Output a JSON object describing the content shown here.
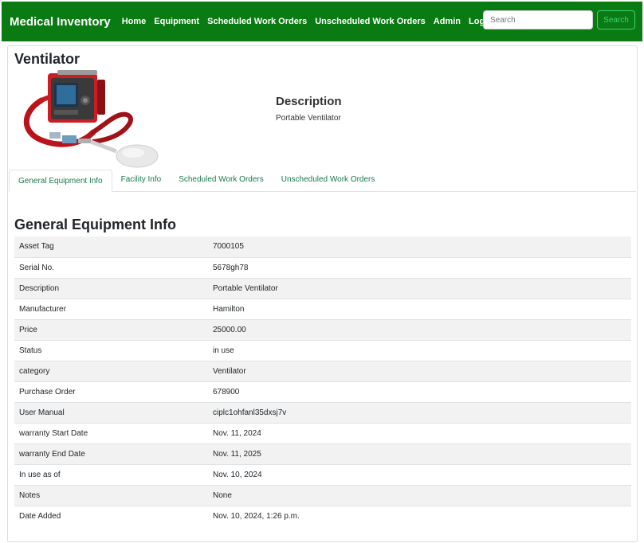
{
  "navbar": {
    "brand": "Medical Inventory",
    "links": [
      "Home",
      "Equipment",
      "Scheduled Work Orders",
      "Unscheduled Work Orders",
      "Admin",
      "Logout"
    ],
    "search_placeholder": "Search",
    "search_button": "Search"
  },
  "equipment": {
    "name": "Ventilator",
    "description_heading": "Description",
    "description": "Portable Ventilator"
  },
  "tabs": [
    {
      "label": "General Equipment Info",
      "active": true
    },
    {
      "label": "Facility Info",
      "active": false
    },
    {
      "label": "Scheduled Work Orders",
      "active": false
    },
    {
      "label": "Unscheduled Work Orders",
      "active": false
    }
  ],
  "info_section": {
    "heading": "General Equipment Info",
    "rows": [
      {
        "label": "Asset Tag",
        "value": "7000105"
      },
      {
        "label": "Serial No.",
        "value": "5678gh78"
      },
      {
        "label": "Description",
        "value": "Portable Ventilator"
      },
      {
        "label": "Manufacturer",
        "value": "Hamilton"
      },
      {
        "label": "Price",
        "value": "25000.00"
      },
      {
        "label": "Status",
        "value": "in use"
      },
      {
        "label": "category",
        "value": "Ventilator"
      },
      {
        "label": "Purchase Order",
        "value": "678900"
      },
      {
        "label": "User Manual",
        "value": "ciplc1ohfanl35dxsj7v"
      },
      {
        "label": "warranty Start Date",
        "value": "Nov. 11, 2024"
      },
      {
        "label": "warranty End Date",
        "value": "Nov. 11, 2025"
      },
      {
        "label": "In use as of",
        "value": "Nov. 10, 2024"
      },
      {
        "label": "Notes",
        "value": "None"
      },
      {
        "label": "Date Added",
        "value": "Nov. 10, 2024, 1:26 p.m."
      }
    ]
  },
  "colors": {
    "navbar_bg": "#0a7a12",
    "search_button": "#3fd17a",
    "tab_link": "#1b7a4e",
    "row_stripe": "#f2f2f2"
  }
}
